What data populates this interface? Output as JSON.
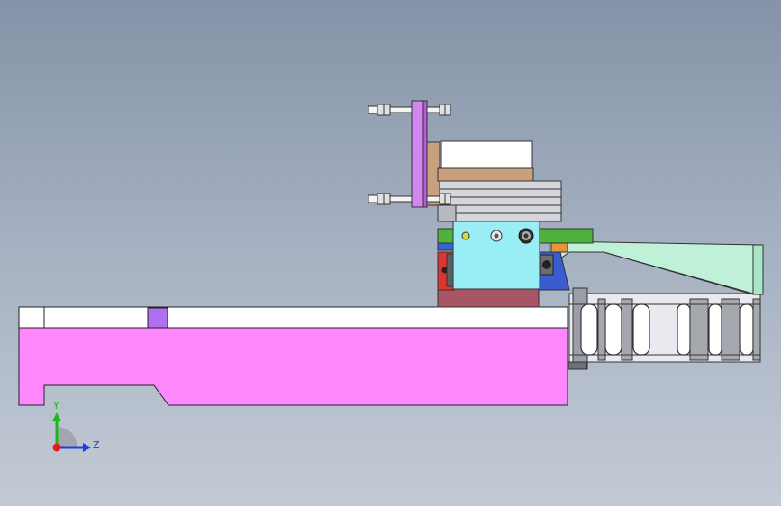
{
  "viewport": {
    "colors": {
      "background_top": "#8593a8",
      "background_bottom": "#c3cad5",
      "base_body": "#ff88ff",
      "base_rail": "#ffffff",
      "slot_block": "#b06ef0",
      "carriage_block": "#98eef4",
      "mount_plate": "#a85565",
      "green_plate": "#4db33d",
      "tan_block": "#c9a07e",
      "bracket": "#d386f0",
      "support_bracket": "#bff0d8",
      "chain": "#c8c8c8"
    }
  },
  "triad": {
    "y_label": "Y",
    "z_label": "Z",
    "y_color": "#21b421",
    "z_color": "#1f3fd6",
    "origin_color": "#e01c1c"
  }
}
